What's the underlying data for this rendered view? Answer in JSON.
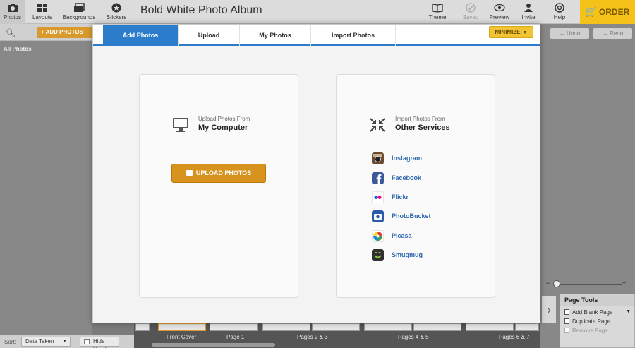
{
  "toolbar": {
    "tools": [
      {
        "label": "Photos",
        "icon": "camera-icon"
      },
      {
        "label": "Layouts",
        "icon": "layouts-icon"
      },
      {
        "label": "Backgrounds",
        "icon": "backgrounds-icon"
      },
      {
        "label": "Stickers",
        "icon": "sticker-icon"
      }
    ],
    "title": "Bold White Photo Album",
    "right_tools": [
      {
        "label": "Theme",
        "icon": "book-icon"
      },
      {
        "label": "Saved",
        "icon": "check-icon"
      },
      {
        "label": "Preview",
        "icon": "eye-icon"
      },
      {
        "label": "Invite",
        "icon": "person-icon"
      },
      {
        "label": "Help",
        "icon": "lifebuoy-icon"
      }
    ],
    "order_label": "ORDER"
  },
  "sidebar": {
    "add_photos_label": "+ ADD PHOTOS",
    "all_photos_label": "All Photos",
    "sort_label": "Sort:",
    "sort_value": "Date Taken",
    "hide_used_label": "Hide Used"
  },
  "edit": {
    "undo_label": "Undo",
    "redo_label": "Redo"
  },
  "page_tools": {
    "title": "Page Tools",
    "items": [
      "Add Blank Page",
      "Duplicate Page",
      "Remove Page"
    ]
  },
  "filmstrip": {
    "pages": [
      "Front Cover",
      "Page 1",
      "Pages 2 & 3",
      "Pages 4 & 5",
      "Pages 6 & 7"
    ]
  },
  "modal": {
    "tabs": [
      "Add Photos",
      "Upload",
      "My Photos",
      "Import Photos"
    ],
    "minimize_label": "MINIMIZE",
    "computer": {
      "small": "Upload Photos From",
      "big": "My Computer",
      "button_label": "UPLOAD PHOTOS"
    },
    "services": {
      "small": "Import Photos From",
      "big": "Other Services",
      "items": [
        "Instagram",
        "Facebook",
        "Flickr",
        "PhotoBucket",
        "Picasa",
        "Smugmug"
      ]
    }
  },
  "colors": {
    "accent_blue": "#2b7ccb",
    "upload_orange": "#d8931f",
    "order_yellow": "#f5c21a",
    "link_blue": "#2c67ad"
  }
}
